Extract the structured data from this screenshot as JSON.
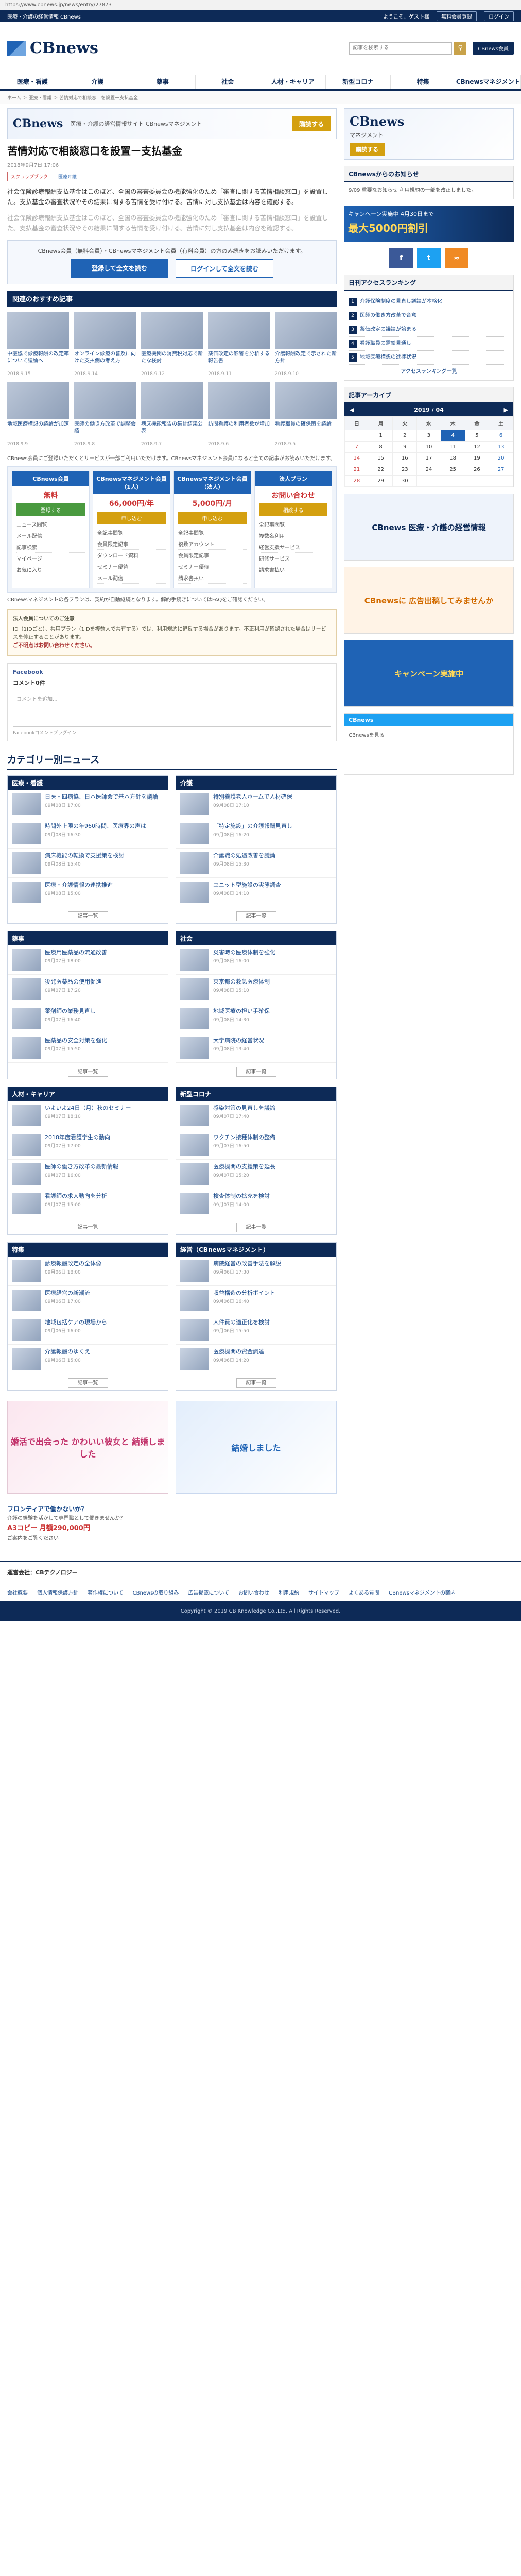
{
  "browser": {
    "url": "https://www.cbnews.jp/news/entry/27873"
  },
  "topbar": {
    "left": "医療・介護の経営情報 CBnews",
    "welcome": "ようこそ、ゲスト様",
    "register": "無料会員登録",
    "login": "ログイン"
  },
  "header": {
    "logo": "CBnews",
    "search_placeholder": "記事を検索する",
    "member_btn": "CBnews会員"
  },
  "nav": [
    "医療・看護",
    "介護",
    "薬事",
    "社会",
    "人材・キャリア",
    "新型コロナ",
    "特集",
    "CBnewsマネジメント"
  ],
  "breadcrumb": "ホーム ＞ 医療・看護 ＞ 苦情対応で相談窓口を設置ー支払基金",
  "top_banner": {
    "logo": "CBnews",
    "text": "医療・介護の経営情報サイト CBnewsマネジメント",
    "btn": "購読する"
  },
  "article": {
    "title": "苦情対応で相談窓口を設置ー支払基金",
    "meta": "2018年9月7日 17:06",
    "tags": [
      "スクラップブック",
      "医療介護"
    ],
    "p1": "社会保険診療報酬支払基金はこのほど、全国の審査委員会の機能強化のため「審査に関する苦情相談窓口」を設置した。支払基金の審査状況やその結果に関する苦情を受け付ける。苦情に対し支払基金は内容を確認する。",
    "p2": "社会保険診療報酬支払基金はこのほど、全国の審査委員会の機能強化のため「審査に関する苦情相談窓口」を設置した。支払基金の審査状況やその結果に関する苦情を受け付ける。苦情に対し支払基金は内容を確認する。",
    "cta_lead": "CBnews会員（無料会員）・CBnewsマネジメント会員（有料会員）の方のみ続きをお読みいただけます。",
    "cta_register": "登録して全文を読む",
    "cta_login": "ログインして全文を読む"
  },
  "recommend": {
    "heading": "関連のおすすめ記事",
    "items": [
      {
        "t": "中医協で診療報酬の改定率について議論へ",
        "d": "2018.9.15"
      },
      {
        "t": "オンライン診療の普及に向けた支払側の考え方",
        "d": "2018.9.14"
      },
      {
        "t": "医療機関の消費税対応で新たな検討",
        "d": "2018.9.12"
      },
      {
        "t": "薬価改定の影響を分析する報告書",
        "d": "2018.9.11"
      },
      {
        "t": "介護報酬改定で示された新方針",
        "d": "2018.9.10"
      },
      {
        "t": "地域医療構想の議論が加速",
        "d": "2018.9.9"
      },
      {
        "t": "医師の働き方改革で調整会議",
        "d": "2018.9.8"
      },
      {
        "t": "病床機能報告の集計結果公表",
        "d": "2018.9.7"
      },
      {
        "t": "訪問看護の利用者数が増加",
        "d": "2018.9.6"
      },
      {
        "t": "看護職員の確保策を議論",
        "d": "2018.9.5"
      }
    ]
  },
  "plans": {
    "note": "CBnews会員にご登録いただくとサービスが一部ご利用いただけます。CBnewsマネジメント会員になると全ての記事がお読みいただけます。",
    "cols": [
      {
        "name": "CBnews会員",
        "price": "無料",
        "btn": "登録する",
        "items": [
          "ニュース閲覧",
          "メール配信",
          "記事検索",
          "マイページ",
          "お気に入り"
        ]
      },
      {
        "name": "CBnewsマネジメント会員（1人）",
        "price": "66,000円/年",
        "btn": "申し込む",
        "items": [
          "全記事閲覧",
          "会員限定記事",
          "ダウンロード資料",
          "セミナー優待",
          "メール配信"
        ]
      },
      {
        "name": "CBnewsマネジメント会員（法人）",
        "price": "5,000円/月",
        "btn": "申し込む",
        "items": [
          "全記事閲覧",
          "複数アカウント",
          "会員限定記事",
          "セミナー優待",
          "請求書払い"
        ]
      },
      {
        "name": "法人プラン",
        "price": "お問い合わせ",
        "btn": "相談する",
        "items": [
          "全記事閲覧",
          "複数名利用",
          "経営支援サービス",
          "研修サービス",
          "請求書払い"
        ]
      }
    ],
    "footer_note": "CBnewsマネジメントの各プランは、契約が自動継続となります。解約手続きについてはFAQをご確認ください。"
  },
  "notice": {
    "head": "法人会員についてのご注意",
    "body": "ID（1IDごと）、共用プラン（1IDを複数人で共有する）では、利用規約に違反する場合があります。不正利用が確認された場合はサービスを停止することがあります。",
    "warn": "ご不明点はお問い合わせください。"
  },
  "fb": {
    "label": "Facebook",
    "comments": "コメント0件",
    "placeholder": "コメントを追加...",
    "plugin": "Facebookコメントプラグイン"
  },
  "categories": {
    "title": "カテゴリー別ニュース",
    "cols": [
      {
        "name": "医療・看護",
        "items": [
          {
            "t": "日医・四病協、日本医師会で基本方針を議論",
            "d": "09月08日 17:00"
          },
          {
            "t": "時間外上限の年960時間、医療界の声は",
            "d": "09月08日 16:30"
          },
          {
            "t": "病床機能の転換で支援策を検討",
            "d": "09月08日 15:40"
          },
          {
            "t": "医療・介護情報の連携推進",
            "d": "09月08日 15:00"
          }
        ]
      },
      {
        "name": "介護",
        "items": [
          {
            "t": "特別養護老人ホームで人材確保",
            "d": "09月08日 17:10"
          },
          {
            "t": "「特定施設」の介護報酬見直し",
            "d": "09月08日 16:20"
          },
          {
            "t": "介護職の処遇改善を議論",
            "d": "09月08日 15:30"
          },
          {
            "t": "ユニット型施設の実態調査",
            "d": "09月08日 14:10"
          }
        ]
      },
      {
        "name": "薬事",
        "items": [
          {
            "t": "医療用医薬品の流通改善",
            "d": "09月07日 18:00"
          },
          {
            "t": "後発医薬品の使用促進",
            "d": "09月07日 17:20"
          },
          {
            "t": "薬剤師の業務見直し",
            "d": "09月07日 16:40"
          },
          {
            "t": "医薬品の安全対策を強化",
            "d": "09月07日 15:50"
          }
        ]
      },
      {
        "name": "社会",
        "items": [
          {
            "t": "災害時の医療体制を強化",
            "d": "09月08日 16:00"
          },
          {
            "t": "東京都の救急医療体制",
            "d": "09月08日 15:10"
          },
          {
            "t": "地域医療の担い手確保",
            "d": "09月08日 14:30"
          },
          {
            "t": "大学病院の経営状況",
            "d": "09月08日 13:40"
          }
        ]
      },
      {
        "name": "人材・キャリア",
        "items": [
          {
            "t": "いよいよ24日（月）秋のセミナー",
            "d": "09月07日 18:10"
          },
          {
            "t": "2018年度看護学生の動向",
            "d": "09月07日 17:00"
          },
          {
            "t": "医師の働き方改革の最新情報",
            "d": "09月07日 16:00"
          },
          {
            "t": "看護師の求人動向を分析",
            "d": "09月07日 15:00"
          }
        ]
      },
      {
        "name": "新型コロナ",
        "items": [
          {
            "t": "感染対策の見直しを議論",
            "d": "09月07日 17:40"
          },
          {
            "t": "ワクチン接種体制の整備",
            "d": "09月07日 16:50"
          },
          {
            "t": "医療機関の支援策を延長",
            "d": "09月07日 15:20"
          },
          {
            "t": "検査体制の拡充を検討",
            "d": "09月07日 14:00"
          }
        ]
      },
      {
        "name": "特集",
        "items": [
          {
            "t": "診療報酬改定の全体像",
            "d": "09月06日 18:00"
          },
          {
            "t": "医療経営の新潮流",
            "d": "09月06日 17:00"
          },
          {
            "t": "地域包括ケアの現場から",
            "d": "09月06日 16:00"
          },
          {
            "t": "介護報酬のゆくえ",
            "d": "09月06日 15:00"
          }
        ]
      },
      {
        "name": "経営（CBnewsマネジメント）",
        "items": [
          {
            "t": "病院経営の改善手法を解説",
            "d": "09月06日 17:30"
          },
          {
            "t": "収益構造の分析ポイント",
            "d": "09月06日 16:40"
          },
          {
            "t": "人件費の適正化を検討",
            "d": "09月06日 15:50"
          },
          {
            "t": "医療機関の資金調達",
            "d": "09月06日 14:20"
          }
        ]
      }
    ],
    "more": "記事一覧"
  },
  "ads": {
    "a1": "婚活で出会った かわいい彼女と 結婚しました",
    "a2": "結婚しました",
    "line1": "フロンティアで働かないか？",
    "line2": "介護の経験を活かして専門職として働きませんか？",
    "price": "A3コピー 月額290,000円",
    "sub": "ご案内をご覧ください"
  },
  "side": {
    "banner": {
      "logo": "CBnews",
      "sub": "マネジメント",
      "btn": "購読する"
    },
    "notice_head": "CBnewsからのお知らせ",
    "notice_body": "9/09 重要なお知らせ 利用規約の一部を改正しました。",
    "campaign": {
      "line1": "キャンペーン実施中 4月30日まで",
      "line2": "最大5000円割引"
    },
    "access_head": "日刊アクセスランキング",
    "access": [
      "介護保険制度の見直し議論が本格化",
      "医師の働き方改革で合意",
      "薬価改定の議論が始まる",
      "看護職員の需給見通し",
      "地域医療構想の進捗状況"
    ],
    "access_more": "アクセスランキング一覧",
    "calendar": {
      "label": "記事アーカイブ",
      "month": "2019 / 04",
      "days": [
        "日",
        "月",
        "火",
        "水",
        "木",
        "金",
        "土"
      ]
    },
    "ad1": "CBnews 医療・介護の経営情報",
    "ad2": "CBnewsに 広告出稿してみませんか",
    "ad3": "キャンペーン実施中",
    "tw_head": "CBnews",
    "tw_body": "CBnewsを見る"
  },
  "footer": {
    "company": "運営会社：CBテクノロジー",
    "links": [
      "会社概要",
      "個人情報保護方針",
      "著作権について",
      "CBnewsの取り組み",
      "広告掲載について",
      "お問い合わせ",
      "利用規約",
      "サイトマップ",
      "よくある質問",
      "CBnewsマネジメントの案内"
    ],
    "copy": "Copyright © 2019 CB Knowledge Co.,Ltd. All Rights Reserved."
  }
}
